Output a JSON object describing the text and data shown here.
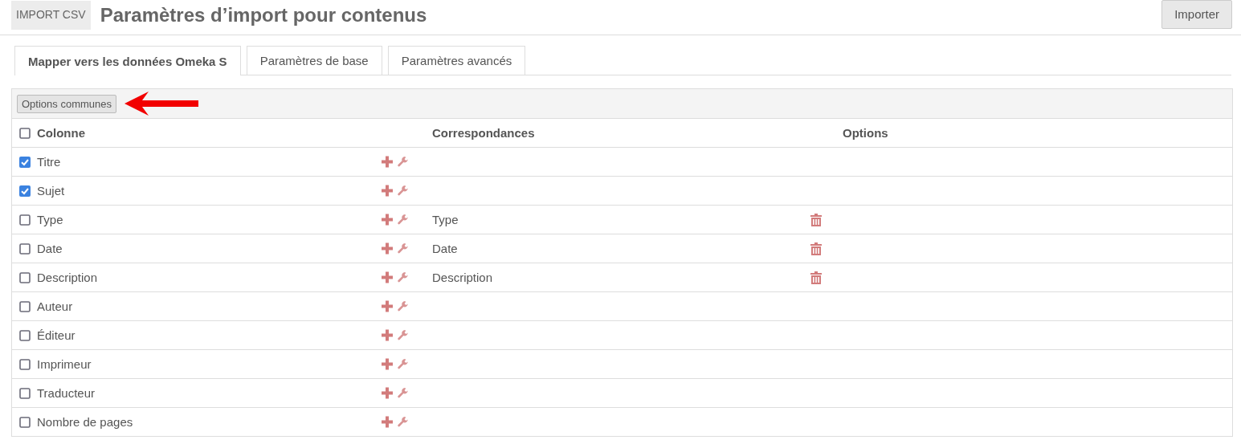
{
  "header": {
    "badge": "IMPORT CSV",
    "title": "Paramètres d’import pour contenus",
    "action": "Importer"
  },
  "tabs": [
    {
      "label": "Mapper vers les données Omeka S",
      "selected": true
    },
    {
      "label": "Paramètres de base",
      "selected": false
    },
    {
      "label": "Paramètres avancés",
      "selected": false
    }
  ],
  "toolbar": {
    "button": "Options communes",
    "annotation_arrow": true
  },
  "table": {
    "select_all": {
      "checked": false
    },
    "columns": [
      "Colonne",
      "Correspondances",
      "Options"
    ],
    "rows": [
      {
        "name": "Titre",
        "checked": true
      },
      {
        "name": "Sujet",
        "checked": true
      },
      {
        "name": "Type",
        "checked": false,
        "mapping": "Type"
      },
      {
        "name": "Date",
        "checked": false,
        "mapping": "Date"
      },
      {
        "name": "Description",
        "checked": false,
        "mapping": "Description"
      },
      {
        "name": "Auteur",
        "checked": false
      },
      {
        "name": "Éditeur",
        "checked": false
      },
      {
        "name": "Imprimeur",
        "checked": false
      },
      {
        "name": "Traducteur",
        "checked": false
      },
      {
        "name": "Nombre de pages",
        "checked": false
      }
    ]
  }
}
